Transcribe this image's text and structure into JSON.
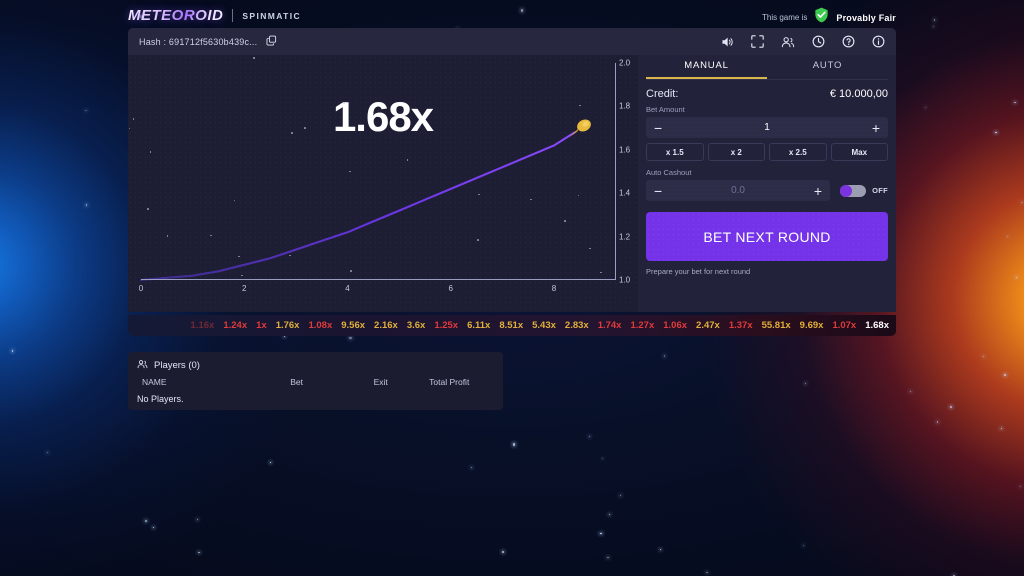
{
  "topbar": {
    "logo": "METEOROID",
    "logo_icon": "comet-icon",
    "provider": "SPINMATIC",
    "fair_prefix": "This game is",
    "fair_icon": "shield-check-icon",
    "fair_label": "Provably Fair"
  },
  "game_header": {
    "hash_text": "Hash : 691712f5630b439c...",
    "copy_icon": "copy-icon",
    "icons": [
      {
        "name": "volume-icon",
        "title": "Sound"
      },
      {
        "name": "fullscreen-icon",
        "title": "Fullscreen"
      },
      {
        "name": "players-icon",
        "title": "Players"
      },
      {
        "name": "history-icon",
        "title": "History"
      },
      {
        "name": "help-icon",
        "title": "Help"
      },
      {
        "name": "info-icon",
        "title": "Info"
      }
    ]
  },
  "chart_data": {
    "type": "line",
    "title": "1.68x",
    "xlabel": "",
    "ylabel": "",
    "xlim": [
      0,
      9.2
    ],
    "ylim": [
      1.0,
      2.0
    ],
    "xticks": [
      "0",
      "2",
      "4",
      "6",
      "8"
    ],
    "xtick_values": [
      0,
      2,
      4,
      6,
      8
    ],
    "yticks": [
      "1.0",
      "1.2",
      "1.4",
      "1.6",
      "1.8",
      "2.0"
    ],
    "ytick_values": [
      1.0,
      1.2,
      1.4,
      1.6,
      1.8,
      2.0
    ],
    "grid": false,
    "legend": null,
    "series": [
      {
        "name": "multiplier",
        "color": "#7b3df5",
        "x": [
          0,
          0.5,
          1.0,
          1.5,
          2.0,
          2.5,
          3.0,
          3.5,
          4.0,
          4.5,
          5.0,
          5.5,
          6.0,
          6.5,
          7.0,
          7.5,
          8.0,
          8.4
        ],
        "y": [
          1.0,
          1.01,
          1.02,
          1.04,
          1.07,
          1.1,
          1.14,
          1.18,
          1.22,
          1.27,
          1.32,
          1.37,
          1.42,
          1.47,
          1.52,
          1.57,
          1.62,
          1.68
        ]
      }
    ],
    "marker": {
      "name": "comet-marker",
      "x": 8.4,
      "y": 1.68,
      "color": "#e8bb3a"
    },
    "current_multiplier": "1.68x"
  },
  "bet_panel": {
    "tabs": [
      {
        "label": "MANUAL",
        "active": true
      },
      {
        "label": "AUTO",
        "active": false
      }
    ],
    "credit_label": "Credit:",
    "credit_value": "€ 10.000,00",
    "bet_amount_label": "Bet Amount",
    "bet_amount_value": "1",
    "minus_sign": "−",
    "plus_sign": "+",
    "quick_bets": [
      "x 1.5",
      "x 2",
      "x 2.5",
      "Max"
    ],
    "auto_cashout_label": "Auto Cashout",
    "auto_cashout_value": "0.0",
    "auto_cashout_toggle": "OFF",
    "bet_button": "BET NEXT ROUND",
    "bet_hint": "Prepare your bet for next round",
    "accent_color": "#7433e8",
    "tab_accent_color": "#d9b64a"
  },
  "history": [
    {
      "value": "1.16x",
      "kind": "red",
      "faded": true
    },
    {
      "value": "1.24x",
      "kind": "red",
      "faded": false
    },
    {
      "value": "1x",
      "kind": "red",
      "faded": false
    },
    {
      "value": "1.76x",
      "kind": "gold",
      "faded": false
    },
    {
      "value": "1.08x",
      "kind": "red",
      "faded": false
    },
    {
      "value": "9.56x",
      "kind": "gold",
      "faded": false
    },
    {
      "value": "2.16x",
      "kind": "gold",
      "faded": false
    },
    {
      "value": "3.6x",
      "kind": "gold",
      "faded": false
    },
    {
      "value": "1.25x",
      "kind": "red",
      "faded": false
    },
    {
      "value": "6.11x",
      "kind": "gold",
      "faded": false
    },
    {
      "value": "8.51x",
      "kind": "gold",
      "faded": false
    },
    {
      "value": "5.43x",
      "kind": "gold",
      "faded": false
    },
    {
      "value": "2.83x",
      "kind": "gold",
      "faded": false
    },
    {
      "value": "1.74x",
      "kind": "red",
      "faded": false
    },
    {
      "value": "1.27x",
      "kind": "red",
      "faded": false
    },
    {
      "value": "1.06x",
      "kind": "red",
      "faded": false
    },
    {
      "value": "2.47x",
      "kind": "gold",
      "faded": false
    },
    {
      "value": "1.37x",
      "kind": "red",
      "faded": false
    },
    {
      "value": "55.81x",
      "kind": "gold",
      "faded": false
    },
    {
      "value": "9.69x",
      "kind": "gold",
      "faded": false
    },
    {
      "value": "1.07x",
      "kind": "red",
      "faded": false
    },
    {
      "value": "1.68x",
      "kind": "cur",
      "faded": false
    }
  ],
  "players": {
    "icon": "players-icon",
    "title": "Players (0)",
    "columns": [
      "NAME",
      "Bet",
      "Exit",
      "Total Profit"
    ],
    "empty_text": "No Players."
  }
}
